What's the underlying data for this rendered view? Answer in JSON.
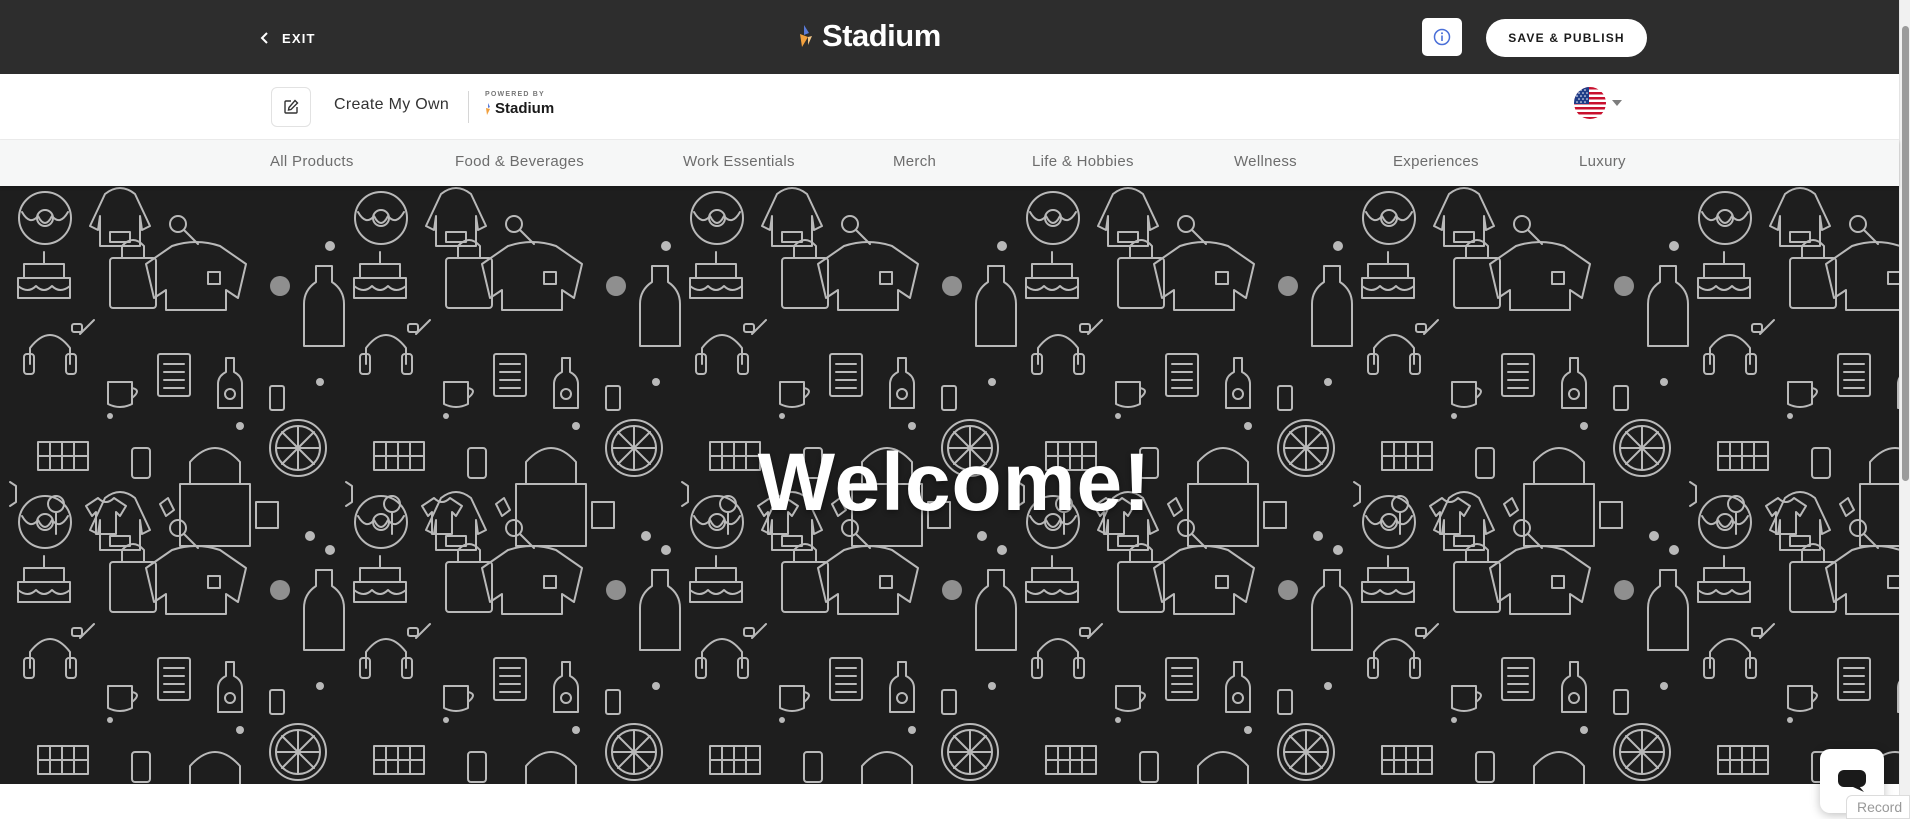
{
  "topbar": {
    "exit_label": "EXIT",
    "brand": "Stadium",
    "publish_label": "SAVE & PUBLISH"
  },
  "store": {
    "name": "Create My Own",
    "powered_by": "POWERED BY",
    "powered_brand": "Stadium",
    "locale_flag": "us-flag-icon"
  },
  "categories": [
    "All Products",
    "Food & Beverages",
    "Work Essentials",
    "Merch",
    "Life & Hobbies",
    "Wellness",
    "Experiences",
    "Luxury"
  ],
  "hero": {
    "heading": "Welcome!"
  },
  "widget": {
    "recorder_label": "Record"
  },
  "colors": {
    "topbar_bg": "#2d2d2d",
    "hero_bg": "#1e1e1e",
    "nav_bg": "#f6f7f7",
    "brand_orange": "#f2a03d",
    "brand_blue": "#5a7bd8"
  }
}
